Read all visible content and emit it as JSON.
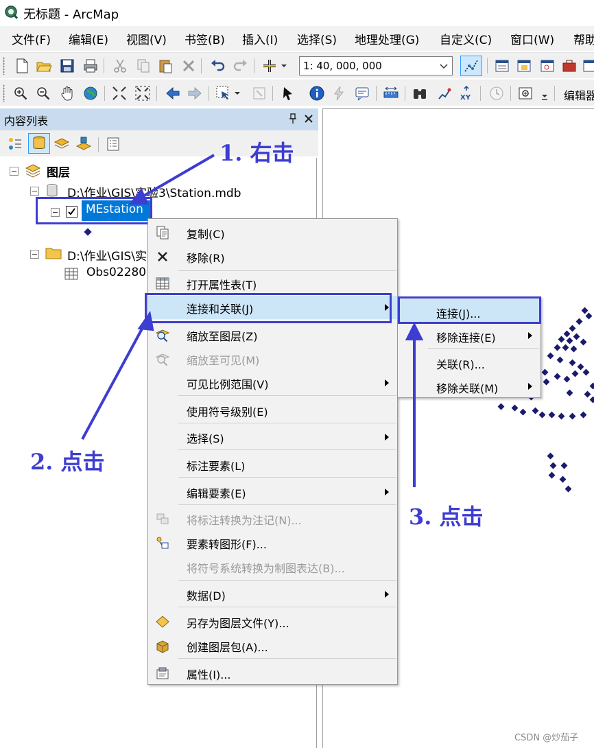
{
  "window": {
    "title": "无标题 - ArcMap"
  },
  "menubar": {
    "items": [
      "文件(F)",
      "编辑(E)",
      "视图(V)",
      "书签(B)",
      "插入(I)",
      "选择(S)",
      "地理处理(G)",
      "自定义(C)",
      "窗口(W)",
      "帮助"
    ]
  },
  "toolbar": {
    "scale": "1: 40, 000, 000",
    "edit_label": "编辑器"
  },
  "toc": {
    "title": "内容列表",
    "root_label": "图层",
    "db_path": "D:\\作业\\GIS\\实验3\\Station.mdb",
    "layer_name": "MEstation",
    "folder_path": "D:\\作业\\GIS\\实",
    "table_name": "Obs02280"
  },
  "context_menu": {
    "items": [
      {
        "label": "复制(C)",
        "icon": "copy-icon"
      },
      {
        "label": "移除(R)",
        "icon": "remove-icon"
      },
      {
        "label": "打开属性表(T)",
        "icon": "table-icon"
      },
      {
        "label": "连接和关联(J)",
        "icon": "",
        "submenu": true,
        "highlighted": true
      },
      {
        "label": "缩放至图层(Z)",
        "icon": "zoom-layer-icon"
      },
      {
        "label": "缩放至可见(M)",
        "icon": "zoom-visible-icon",
        "disabled": true
      },
      {
        "label": "可见比例范围(V)",
        "icon": "",
        "submenu": true
      },
      {
        "label": "使用符号级别(E)",
        "icon": ""
      },
      {
        "label": "选择(S)",
        "icon": "",
        "submenu": true
      },
      {
        "label": "标注要素(L)",
        "icon": ""
      },
      {
        "label": "编辑要素(E)",
        "icon": "",
        "submenu": true
      },
      {
        "label": "将标注转换为注记(N)...",
        "icon": "convert-labels-icon",
        "disabled": true
      },
      {
        "label": "要素转图形(F)...",
        "icon": "features-to-graphics-icon"
      },
      {
        "label": "将符号系统转换为制图表达(B)...",
        "icon": "",
        "disabled": true
      },
      {
        "label": "数据(D)",
        "icon": "",
        "submenu": true
      },
      {
        "label": "另存为图层文件(Y)...",
        "icon": "layer-file-icon"
      },
      {
        "label": "创建图层包(A)...",
        "icon": "layer-package-icon"
      },
      {
        "label": "属性(I)...",
        "icon": "properties-icon"
      }
    ]
  },
  "submenu": {
    "items": [
      {
        "label": "连接(J)...",
        "highlighted": true
      },
      {
        "label": "移除连接(E)",
        "submenu": true
      },
      {
        "label": "关联(R)..."
      },
      {
        "label": "移除关联(M)",
        "submenu": true
      }
    ]
  },
  "annotations": {
    "step1": "1. 右击",
    "step2": "2. 点击",
    "step3": "3. 点击",
    "color": "#3d3dd1"
  },
  "watermark": "CSDN @炒茄子"
}
